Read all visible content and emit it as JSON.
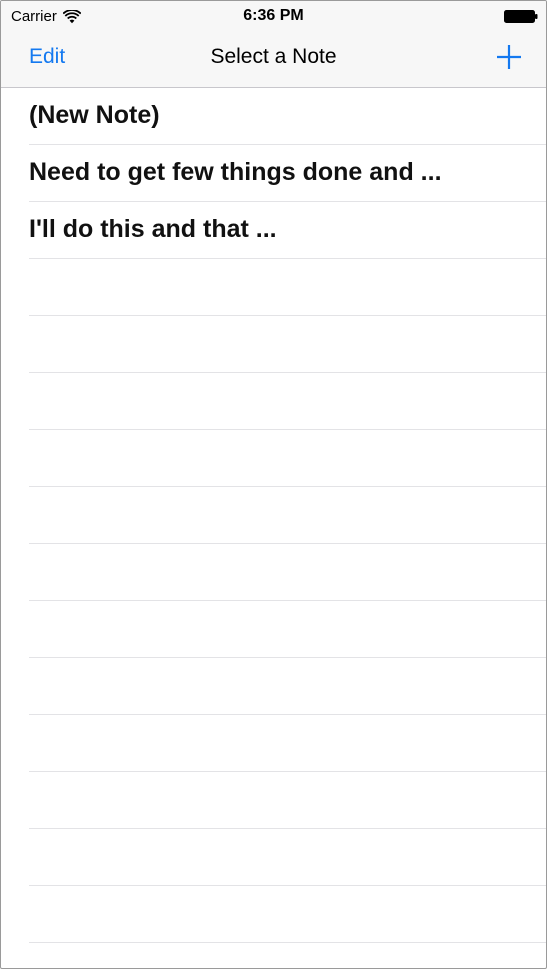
{
  "status_bar": {
    "carrier": "Carrier",
    "time": "6:36 PM",
    "icons": [
      "wifi-icon",
      "battery-icon"
    ]
  },
  "nav_bar": {
    "edit_label": "Edit",
    "title": "Select a Note",
    "add_icon": "plus-icon",
    "accent_color": "#1479f0"
  },
  "notes": [
    {
      "label": "(New Note)"
    },
    {
      "label": "Need to get few things done and ..."
    },
    {
      "label": "I'll do this and that ..."
    }
  ]
}
